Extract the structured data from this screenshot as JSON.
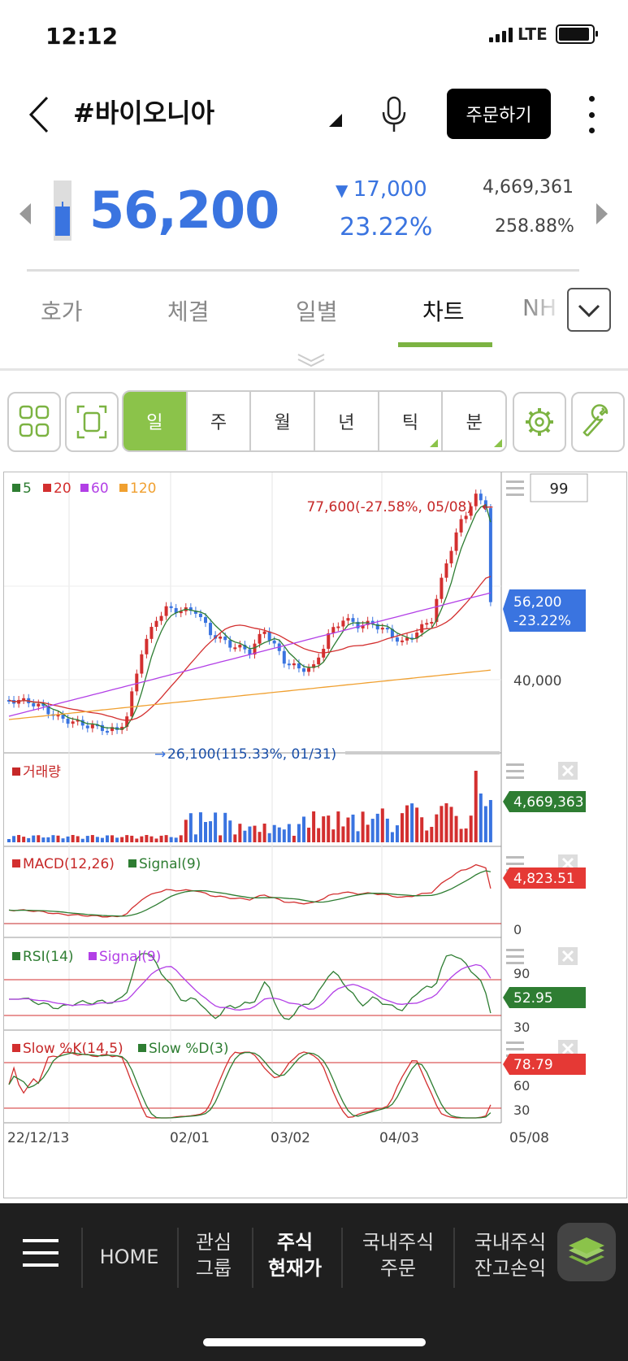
{
  "status": {
    "time": "12:12",
    "network": "LTE"
  },
  "header": {
    "stock_name": "#바이오니아",
    "order_label": "주문하기"
  },
  "price": {
    "current": "56,200",
    "change": "17,000",
    "change_pct": "23.22%",
    "volume": "4,669,361",
    "turnover_pct": "258.88%"
  },
  "tabs": [
    "호가",
    "체결",
    "일별",
    "차트",
    "NH"
  ],
  "active_tab": "차트",
  "periods": [
    "일",
    "주",
    "월",
    "년",
    "틱",
    "분"
  ],
  "active_period": "일",
  "chart": {
    "count_box": "99",
    "legend_ma": [
      {
        "label": "5",
        "color": "#2e7d32"
      },
      {
        "label": "20",
        "color": "#d32f2f"
      },
      {
        "label": "60",
        "color": "#b23fe6"
      },
      {
        "label": "120",
        "color": "#f0a030"
      }
    ],
    "high_annot": "77,600(-27.58%, 05/08)",
    "low_annot": "26,100(115.33%, 01/31)",
    "price_tag": "56,200",
    "price_tag_pct": "-23.22%",
    "price_axis": "40,000",
    "volume_label": "거래량",
    "volume_tag": "4,669,363",
    "macd_label": "MACD(12,26)",
    "macd_signal_label": "Signal(9)",
    "macd_tag": "4,823.51",
    "macd_axis": "0",
    "rsi_label": "RSI(14)",
    "rsi_signal_label": "Signal(9)",
    "rsi_tag": "52.95",
    "rsi_axis_top": "90",
    "rsi_axis_bottom": "30",
    "slow_k_label": "Slow %K(14,5)",
    "slow_d_label": "Slow %D(3)",
    "slow_tag": "78.79",
    "slow_axis_top": "60",
    "slow_axis_bottom": "30",
    "x_labels": [
      "22/12/13",
      "02/01",
      "03/02",
      "04/03",
      "05/08"
    ]
  },
  "chart_data": {
    "type": "candlestick",
    "x": [
      "22/12/13",
      "02/01",
      "03/02",
      "04/03",
      "05/08"
    ],
    "last_close": 56200,
    "period_high": 77600,
    "period_low": 26100,
    "last_volume": 4669363,
    "macd_last": 4823.51,
    "rsi_last": 52.95,
    "slow_k_last": 78.79
  },
  "bottom_nav": [
    {
      "line1": "HOME",
      "line2": ""
    },
    {
      "line1": "관심",
      "line2": "그룹"
    },
    {
      "line1": "주식",
      "line2": "현재가"
    },
    {
      "line1": "국내주식",
      "line2": "주문"
    },
    {
      "line1": "국내주식",
      "line2": "잔고손익"
    }
  ]
}
